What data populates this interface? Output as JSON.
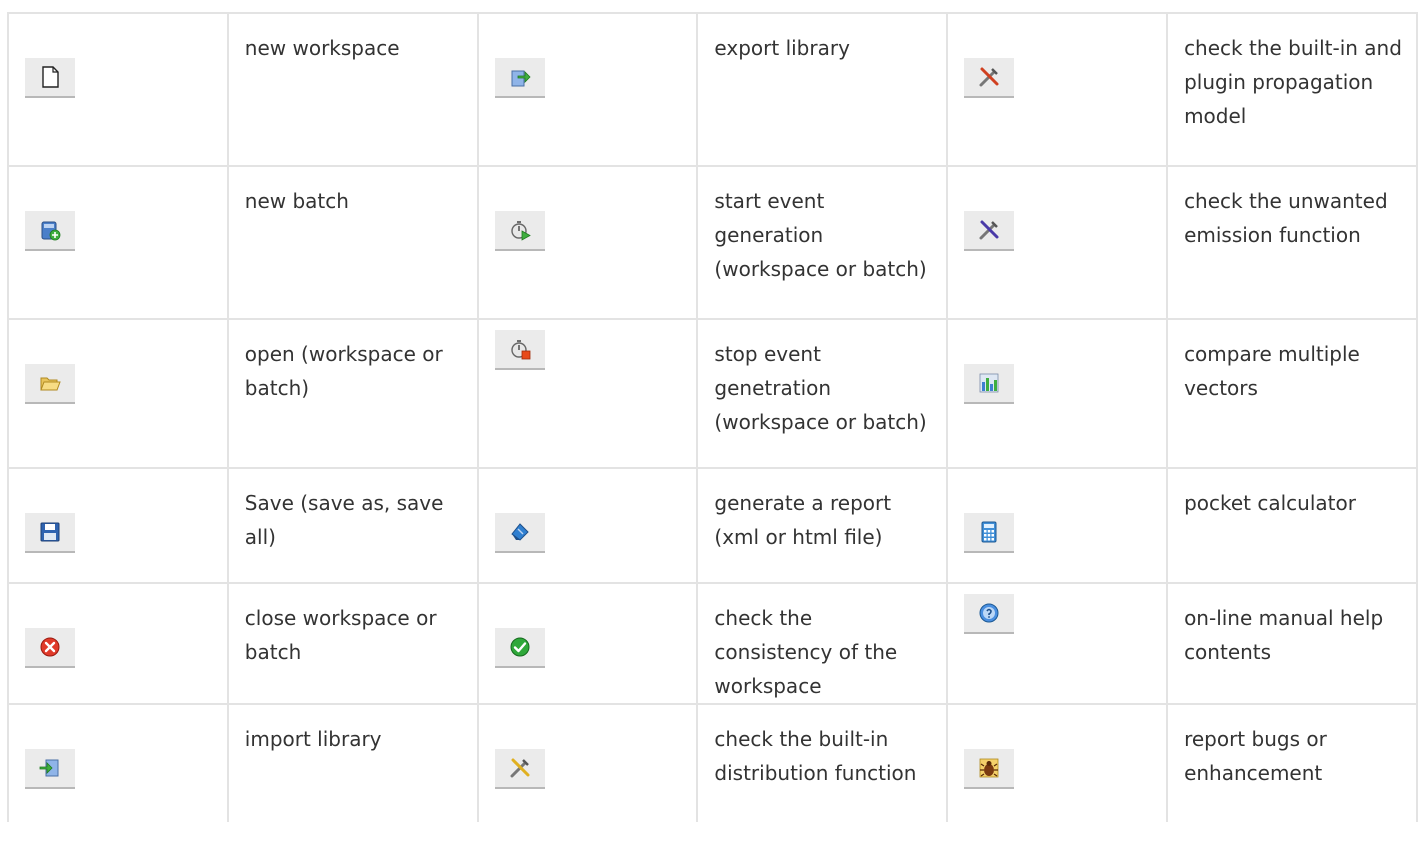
{
  "rows": [
    [
      {
        "icon": "new-document-icon",
        "label": "new workspace"
      },
      {
        "icon": "export-icon",
        "label": "export library"
      },
      {
        "icon": "tools-icon",
        "label": "check the built-in and plugin propagation model"
      }
    ],
    [
      {
        "icon": "new-batch-icon",
        "label": "new batch"
      },
      {
        "icon": "start-generation-icon",
        "label": "start event generation (workspace or batch)"
      },
      {
        "icon": "tools-icon",
        "label": "check the unwanted emission function"
      }
    ],
    [
      {
        "icon": "open-folder-icon",
        "label": "open (workspace or batch)"
      },
      {
        "icon": "stop-generation-icon",
        "label": "stop event genetration (workspace or batch)"
      },
      {
        "icon": "bar-chart-icon",
        "label": "compare multiple vectors"
      }
    ],
    [
      {
        "icon": "save-icon",
        "label": "Save (save as, save all)"
      },
      {
        "icon": "report-icon",
        "label": "generate a report (xml or html file)"
      },
      {
        "icon": "calculator-icon",
        "label": "pocket calculator"
      }
    ],
    [
      {
        "icon": "close-icon",
        "label": "close workspace or batch"
      },
      {
        "icon": "check-icon",
        "label": "check the consistency of the workspace"
      },
      {
        "icon": "help-icon",
        "label": "on-line manual help contents"
      }
    ],
    [
      {
        "icon": "import-icon",
        "label": "import library"
      },
      {
        "icon": "tools-icon",
        "label": "check the built-in distribution function"
      },
      {
        "icon": "bug-icon",
        "label": "report bugs or enhancement"
      }
    ]
  ]
}
